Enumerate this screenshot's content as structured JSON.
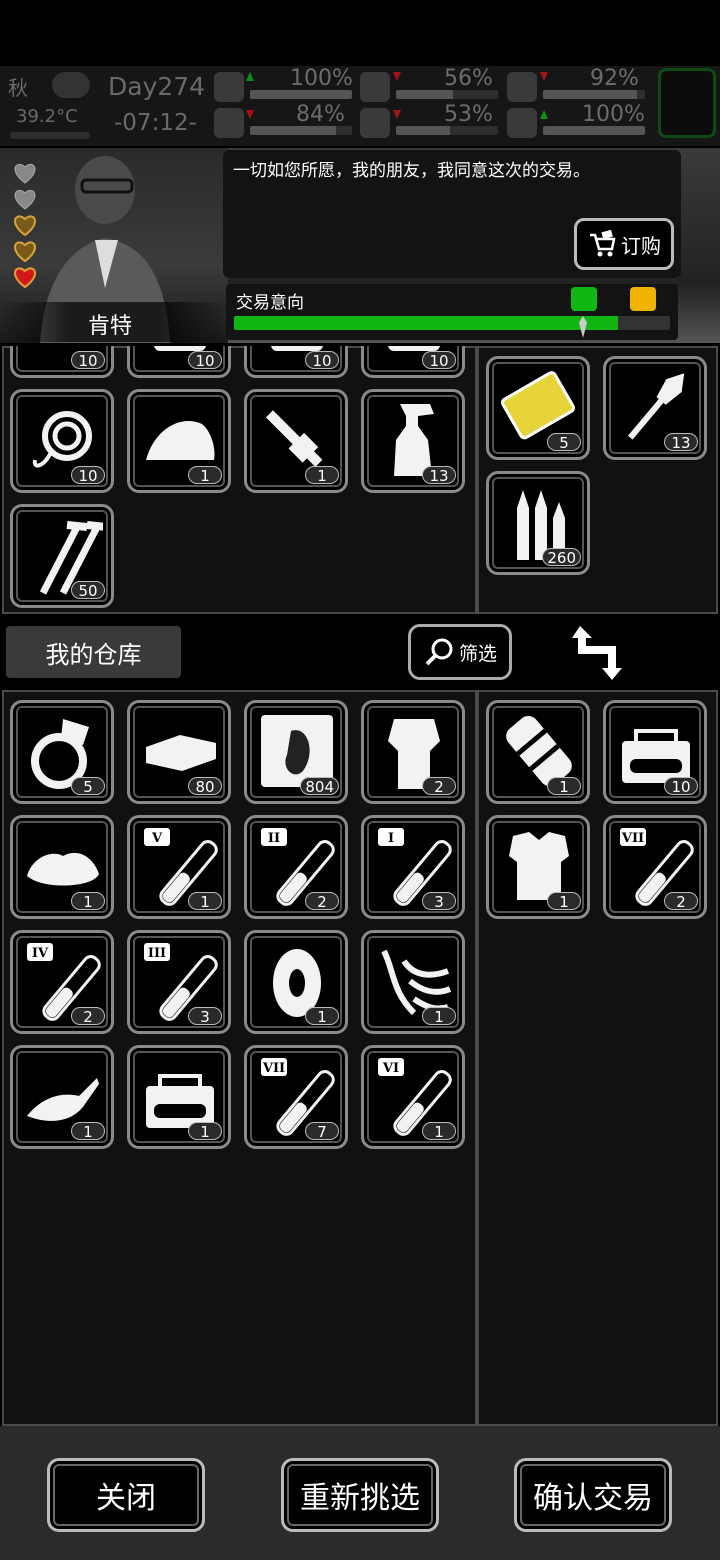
{
  "hud": {
    "season": "秋",
    "temperature": "39.2°C",
    "day": "Day274",
    "time": "-07:12-",
    "stats": [
      {
        "icon": "medkit-icon",
        "trend": "up",
        "value": "100%",
        "level": 1.0
      },
      {
        "icon": "stomach-icon",
        "trend": "down",
        "value": "56%",
        "level": 0.56
      },
      {
        "icon": "bladder-icon",
        "trend": "down",
        "value": "92%",
        "level": 0.92
      },
      {
        "icon": "boot-icon",
        "trend": "down",
        "value": "84%",
        "level": 0.84
      },
      {
        "icon": "water-drop-icon",
        "trend": "down",
        "value": "53%",
        "level": 0.53
      },
      {
        "icon": "heart-icon",
        "trend": "up",
        "value": "100%",
        "level": 1.0
      }
    ]
  },
  "trader": {
    "name": "肯特",
    "dialogue": "一切如您所愿，我的朋友，我同意这次的交易。",
    "order_label": "订购",
    "intent_label": "交易意向",
    "intent_level": 0.88,
    "colors": {
      "good": "#12b612",
      "neutral": "#f0b400"
    }
  },
  "trade_offer": {
    "left_items": [
      {
        "icon": "gear-icon",
        "count": "10"
      },
      {
        "icon": "item-icon",
        "count": "10"
      },
      {
        "icon": "item-icon",
        "count": "10"
      },
      {
        "icon": "item-icon",
        "count": "10"
      },
      {
        "icon": "rope-icon",
        "count": "10"
      },
      {
        "icon": "iron-icon",
        "count": "1"
      },
      {
        "icon": "rifle-part-icon",
        "count": "1"
      },
      {
        "icon": "spray-bottle-icon",
        "count": "13"
      },
      {
        "icon": "screws-icon",
        "count": "50"
      }
    ],
    "right_items": [
      {
        "icon": "gold-card-icon",
        "count": "5"
      },
      {
        "icon": "rocket-icon",
        "count": "13"
      },
      {
        "icon": "bullets-icon",
        "count": "260"
      }
    ]
  },
  "warehouse": {
    "tab_label": "我的仓库",
    "filter_label": "筛选",
    "left_items": [
      {
        "icon": "ring-icon",
        "count": "5"
      },
      {
        "icon": "cash-bundle-icon",
        "count": "80"
      },
      {
        "icon": "zombie-card-icon",
        "count": "804"
      },
      {
        "icon": "fur-coat-icon",
        "count": "2"
      },
      {
        "icon": "cloth-icon",
        "count": "1"
      },
      {
        "icon": "potion-v-icon",
        "tag": "V",
        "count": "1"
      },
      {
        "icon": "potion-ii-icon",
        "tag": "II",
        "count": "2"
      },
      {
        "icon": "potion-i-icon",
        "tag": "I",
        "count": "3"
      },
      {
        "icon": "potion-iv-icon",
        "tag": "IV",
        "count": "2"
      },
      {
        "icon": "potion-iii-icon",
        "tag": "III",
        "count": "3"
      },
      {
        "icon": "tire-icon",
        "count": "1"
      },
      {
        "icon": "claw-icon",
        "count": "1"
      },
      {
        "icon": "jet-icon",
        "count": "1"
      },
      {
        "icon": "car-toolbox-icon",
        "count": "1"
      },
      {
        "icon": "potion-vii-icon",
        "tag": "VII",
        "count": "7"
      },
      {
        "icon": "potion-vi-icon",
        "tag": "VI",
        "count": "1"
      }
    ],
    "right_items": [
      {
        "icon": "arm-guard-icon",
        "count": "1"
      },
      {
        "icon": "toolbox-icon",
        "count": "10"
      },
      {
        "icon": "body-armor-icon",
        "count": "1"
      },
      {
        "icon": "potion-vii-icon",
        "tag": "VII",
        "count": "2"
      }
    ]
  },
  "footer": {
    "close_label": "关闭",
    "reselect_label": "重新挑选",
    "confirm_label": "确认交易"
  }
}
